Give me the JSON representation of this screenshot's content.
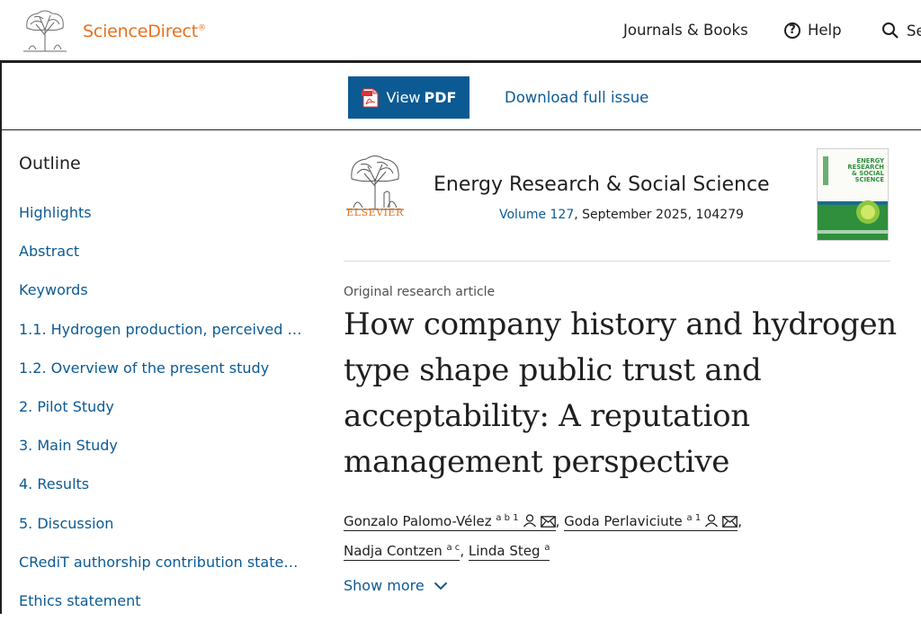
{
  "header": {
    "brand": "ScienceDirect",
    "brand_mark": "®",
    "nav": {
      "journals": "Journals & Books",
      "help": "Help",
      "search": "Se"
    }
  },
  "toolbar": {
    "view_pdf_prefix": "View",
    "view_pdf_bold": "PDF",
    "download": "Download full issue"
  },
  "outline": {
    "title": "Outline",
    "items": [
      "Highlights",
      "Abstract",
      "Keywords",
      "1.1. Hydrogen production, perceived r…",
      "1.2. Overview of the present study",
      "2. Pilot Study",
      "3. Main Study",
      "4. Results",
      "5. Discussion",
      "CRediT authorship contribution state…",
      "Ethics statement"
    ]
  },
  "journal": {
    "publisher": "ELSEVIER",
    "title": "Energy Research & Social Science",
    "volume": "Volume 127",
    "issue_info": ", September 2025, 104279",
    "cover_lines": [
      "ENERGY",
      "RESEARCH",
      "& SOCIAL",
      "SCIENCE"
    ]
  },
  "article": {
    "type": "Original research article",
    "title": "How company history and hydrogen type shape public trust and acceptability: A reputation management perspective",
    "authors": [
      {
        "name": "Gonzalo Palomo-Vélez",
        "sup": "a b 1"
      },
      {
        "name": "Goda Perlaviciute",
        "sup": "a 1"
      },
      {
        "name": "Nadja Contzen",
        "sup": "a c"
      },
      {
        "name": "Linda Steg",
        "sup": "a"
      }
    ],
    "show_more": "Show more"
  },
  "colors": {
    "brand_orange": "#e9711c",
    "link_blue": "#0c5a94",
    "button_blue": "#0c5a94"
  }
}
